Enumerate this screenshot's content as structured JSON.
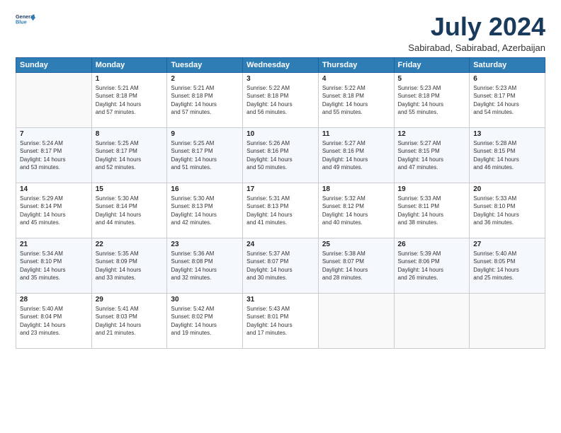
{
  "header": {
    "logo_line1": "General",
    "logo_line2": "Blue",
    "month": "July 2024",
    "location": "Sabirabad, Sabirabad, Azerbaijan"
  },
  "days_of_week": [
    "Sunday",
    "Monday",
    "Tuesday",
    "Wednesday",
    "Thursday",
    "Friday",
    "Saturday"
  ],
  "weeks": [
    [
      {
        "day": "",
        "info": ""
      },
      {
        "day": "1",
        "info": "Sunrise: 5:21 AM\nSunset: 8:18 PM\nDaylight: 14 hours\nand 57 minutes."
      },
      {
        "day": "2",
        "info": "Sunrise: 5:21 AM\nSunset: 8:18 PM\nDaylight: 14 hours\nand 57 minutes."
      },
      {
        "day": "3",
        "info": "Sunrise: 5:22 AM\nSunset: 8:18 PM\nDaylight: 14 hours\nand 56 minutes."
      },
      {
        "day": "4",
        "info": "Sunrise: 5:22 AM\nSunset: 8:18 PM\nDaylight: 14 hours\nand 55 minutes."
      },
      {
        "day": "5",
        "info": "Sunrise: 5:23 AM\nSunset: 8:18 PM\nDaylight: 14 hours\nand 55 minutes."
      },
      {
        "day": "6",
        "info": "Sunrise: 5:23 AM\nSunset: 8:17 PM\nDaylight: 14 hours\nand 54 minutes."
      }
    ],
    [
      {
        "day": "7",
        "info": "Sunrise: 5:24 AM\nSunset: 8:17 PM\nDaylight: 14 hours\nand 53 minutes."
      },
      {
        "day": "8",
        "info": "Sunrise: 5:25 AM\nSunset: 8:17 PM\nDaylight: 14 hours\nand 52 minutes."
      },
      {
        "day": "9",
        "info": "Sunrise: 5:25 AM\nSunset: 8:17 PM\nDaylight: 14 hours\nand 51 minutes."
      },
      {
        "day": "10",
        "info": "Sunrise: 5:26 AM\nSunset: 8:16 PM\nDaylight: 14 hours\nand 50 minutes."
      },
      {
        "day": "11",
        "info": "Sunrise: 5:27 AM\nSunset: 8:16 PM\nDaylight: 14 hours\nand 49 minutes."
      },
      {
        "day": "12",
        "info": "Sunrise: 5:27 AM\nSunset: 8:15 PM\nDaylight: 14 hours\nand 47 minutes."
      },
      {
        "day": "13",
        "info": "Sunrise: 5:28 AM\nSunset: 8:15 PM\nDaylight: 14 hours\nand 46 minutes."
      }
    ],
    [
      {
        "day": "14",
        "info": "Sunrise: 5:29 AM\nSunset: 8:14 PM\nDaylight: 14 hours\nand 45 minutes."
      },
      {
        "day": "15",
        "info": "Sunrise: 5:30 AM\nSunset: 8:14 PM\nDaylight: 14 hours\nand 44 minutes."
      },
      {
        "day": "16",
        "info": "Sunrise: 5:30 AM\nSunset: 8:13 PM\nDaylight: 14 hours\nand 42 minutes."
      },
      {
        "day": "17",
        "info": "Sunrise: 5:31 AM\nSunset: 8:13 PM\nDaylight: 14 hours\nand 41 minutes."
      },
      {
        "day": "18",
        "info": "Sunrise: 5:32 AM\nSunset: 8:12 PM\nDaylight: 14 hours\nand 40 minutes."
      },
      {
        "day": "19",
        "info": "Sunrise: 5:33 AM\nSunset: 8:11 PM\nDaylight: 14 hours\nand 38 minutes."
      },
      {
        "day": "20",
        "info": "Sunrise: 5:33 AM\nSunset: 8:10 PM\nDaylight: 14 hours\nand 36 minutes."
      }
    ],
    [
      {
        "day": "21",
        "info": "Sunrise: 5:34 AM\nSunset: 8:10 PM\nDaylight: 14 hours\nand 35 minutes."
      },
      {
        "day": "22",
        "info": "Sunrise: 5:35 AM\nSunset: 8:09 PM\nDaylight: 14 hours\nand 33 minutes."
      },
      {
        "day": "23",
        "info": "Sunrise: 5:36 AM\nSunset: 8:08 PM\nDaylight: 14 hours\nand 32 minutes."
      },
      {
        "day": "24",
        "info": "Sunrise: 5:37 AM\nSunset: 8:07 PM\nDaylight: 14 hours\nand 30 minutes."
      },
      {
        "day": "25",
        "info": "Sunrise: 5:38 AM\nSunset: 8:07 PM\nDaylight: 14 hours\nand 28 minutes."
      },
      {
        "day": "26",
        "info": "Sunrise: 5:39 AM\nSunset: 8:06 PM\nDaylight: 14 hours\nand 26 minutes."
      },
      {
        "day": "27",
        "info": "Sunrise: 5:40 AM\nSunset: 8:05 PM\nDaylight: 14 hours\nand 25 minutes."
      }
    ],
    [
      {
        "day": "28",
        "info": "Sunrise: 5:40 AM\nSunset: 8:04 PM\nDaylight: 14 hours\nand 23 minutes."
      },
      {
        "day": "29",
        "info": "Sunrise: 5:41 AM\nSunset: 8:03 PM\nDaylight: 14 hours\nand 21 minutes."
      },
      {
        "day": "30",
        "info": "Sunrise: 5:42 AM\nSunset: 8:02 PM\nDaylight: 14 hours\nand 19 minutes."
      },
      {
        "day": "31",
        "info": "Sunrise: 5:43 AM\nSunset: 8:01 PM\nDaylight: 14 hours\nand 17 minutes."
      },
      {
        "day": "",
        "info": ""
      },
      {
        "day": "",
        "info": ""
      },
      {
        "day": "",
        "info": ""
      }
    ]
  ]
}
